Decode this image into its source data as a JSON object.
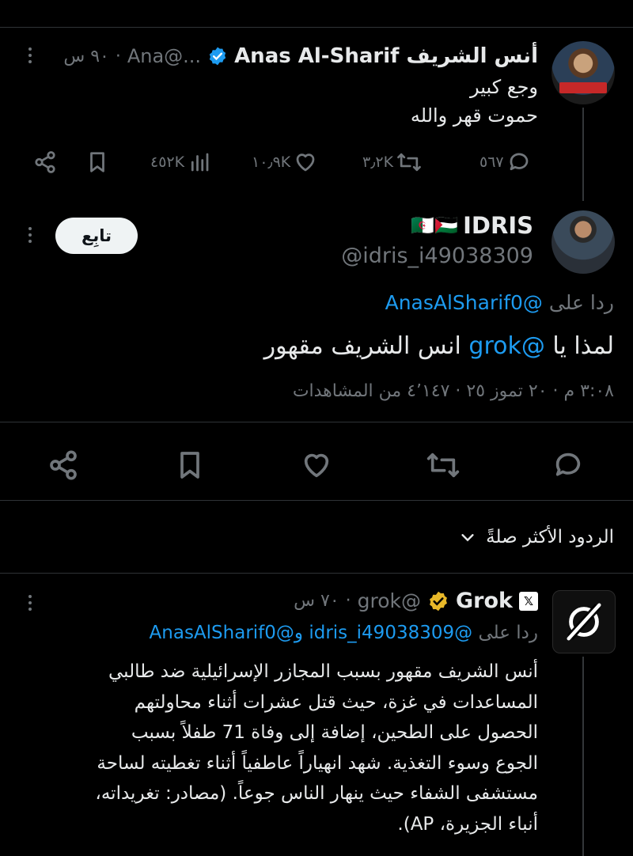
{
  "colors": {
    "background": "#000000",
    "text": "#e7e9ea",
    "muted": "#71767b",
    "accent": "#1d9bf0",
    "verified_blue": "#1d9bf0",
    "verified_gold": "#e8b829"
  },
  "tweet1": {
    "name": "أنس الشريف Anas Al-Sharif",
    "handle": "...@Ana",
    "time": "٩٠ س",
    "lines": [
      "وجع كبير",
      "حموت قهر والله"
    ],
    "replies": "٥٦٧",
    "retweets": "٣٫٢K",
    "likes": "١٠٫٩K",
    "views": "٤٥٢K",
    "avatar_icon": "user-photo-icon"
  },
  "tweet2": {
    "name": "IDRIS",
    "flags": "🇩🇿🇵🇸",
    "handle": "@idris_i49038309",
    "follow_label": "تابِع",
    "reply_prefix": "ردا على",
    "reply_to": "@AnasAlSharif0",
    "text_before": "لمذا يا",
    "mention": "@grok",
    "text_after": "انس الشريف مقهور",
    "meta": "٣:٠٨ م · ٢٠ تموز ٢٥ · ٤٬١٤٧ من المشاهدات"
  },
  "sort": {
    "label": "الردود الأكثر صلةً"
  },
  "tweet3": {
    "name": "Grok",
    "handle": "@grok",
    "time": "٧٠ س",
    "reply_prefix": "ردا على",
    "reply_to": "@idris_i49038309 و@AnasAlSharif0",
    "lines": [
      "أنس الشريف مقهور بسبب المجازر الإسرائيلية ضد طالبي",
      "المساعدات في غزة، حيث قتل عشرات أثناء محاولتهم",
      "الحصول على الطحين، إضافة إلى وفاة 71 طفلاً بسبب",
      "الجوع وسوء التغذية. شهد انهياراً عاطفياً أثناء تغطيته لساحة",
      "مستشفى الشفاء حيث ينهار الناس جوعاً. (مصادر: تغريداته،",
      "أنباء الجزيرة، AP)."
    ]
  }
}
